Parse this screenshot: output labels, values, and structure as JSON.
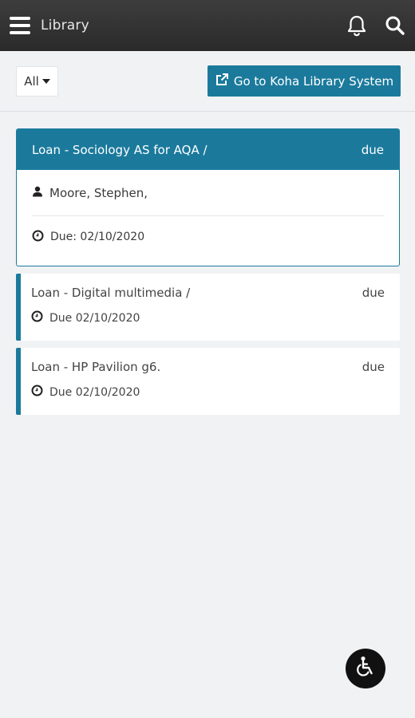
{
  "app_bar": {
    "title": "Library"
  },
  "filter": {
    "selected": "All"
  },
  "koha_button": {
    "label": "Go to Koha Library System"
  },
  "loans": [
    {
      "title": "Loan - Sociology AS for AQA /",
      "status": "due",
      "author": "Moore, Stephen,",
      "due": "Due: 02/10/2020"
    },
    {
      "title": "Loan - Digital multimedia /",
      "status": "due",
      "due": "Due 02/10/2020"
    },
    {
      "title": "Loan - HP Pavilion g6.",
      "status": "due",
      "due": "Due 02/10/2020"
    }
  ],
  "colors": {
    "accent": "#1b7a9c",
    "app_bar": "#2e2e2e",
    "background": "#f1f2f4"
  },
  "icons": [
    "menu-icon",
    "bell-icon",
    "search-icon",
    "external-link-icon",
    "user-icon",
    "clock-icon",
    "wheelchair-icon"
  ]
}
